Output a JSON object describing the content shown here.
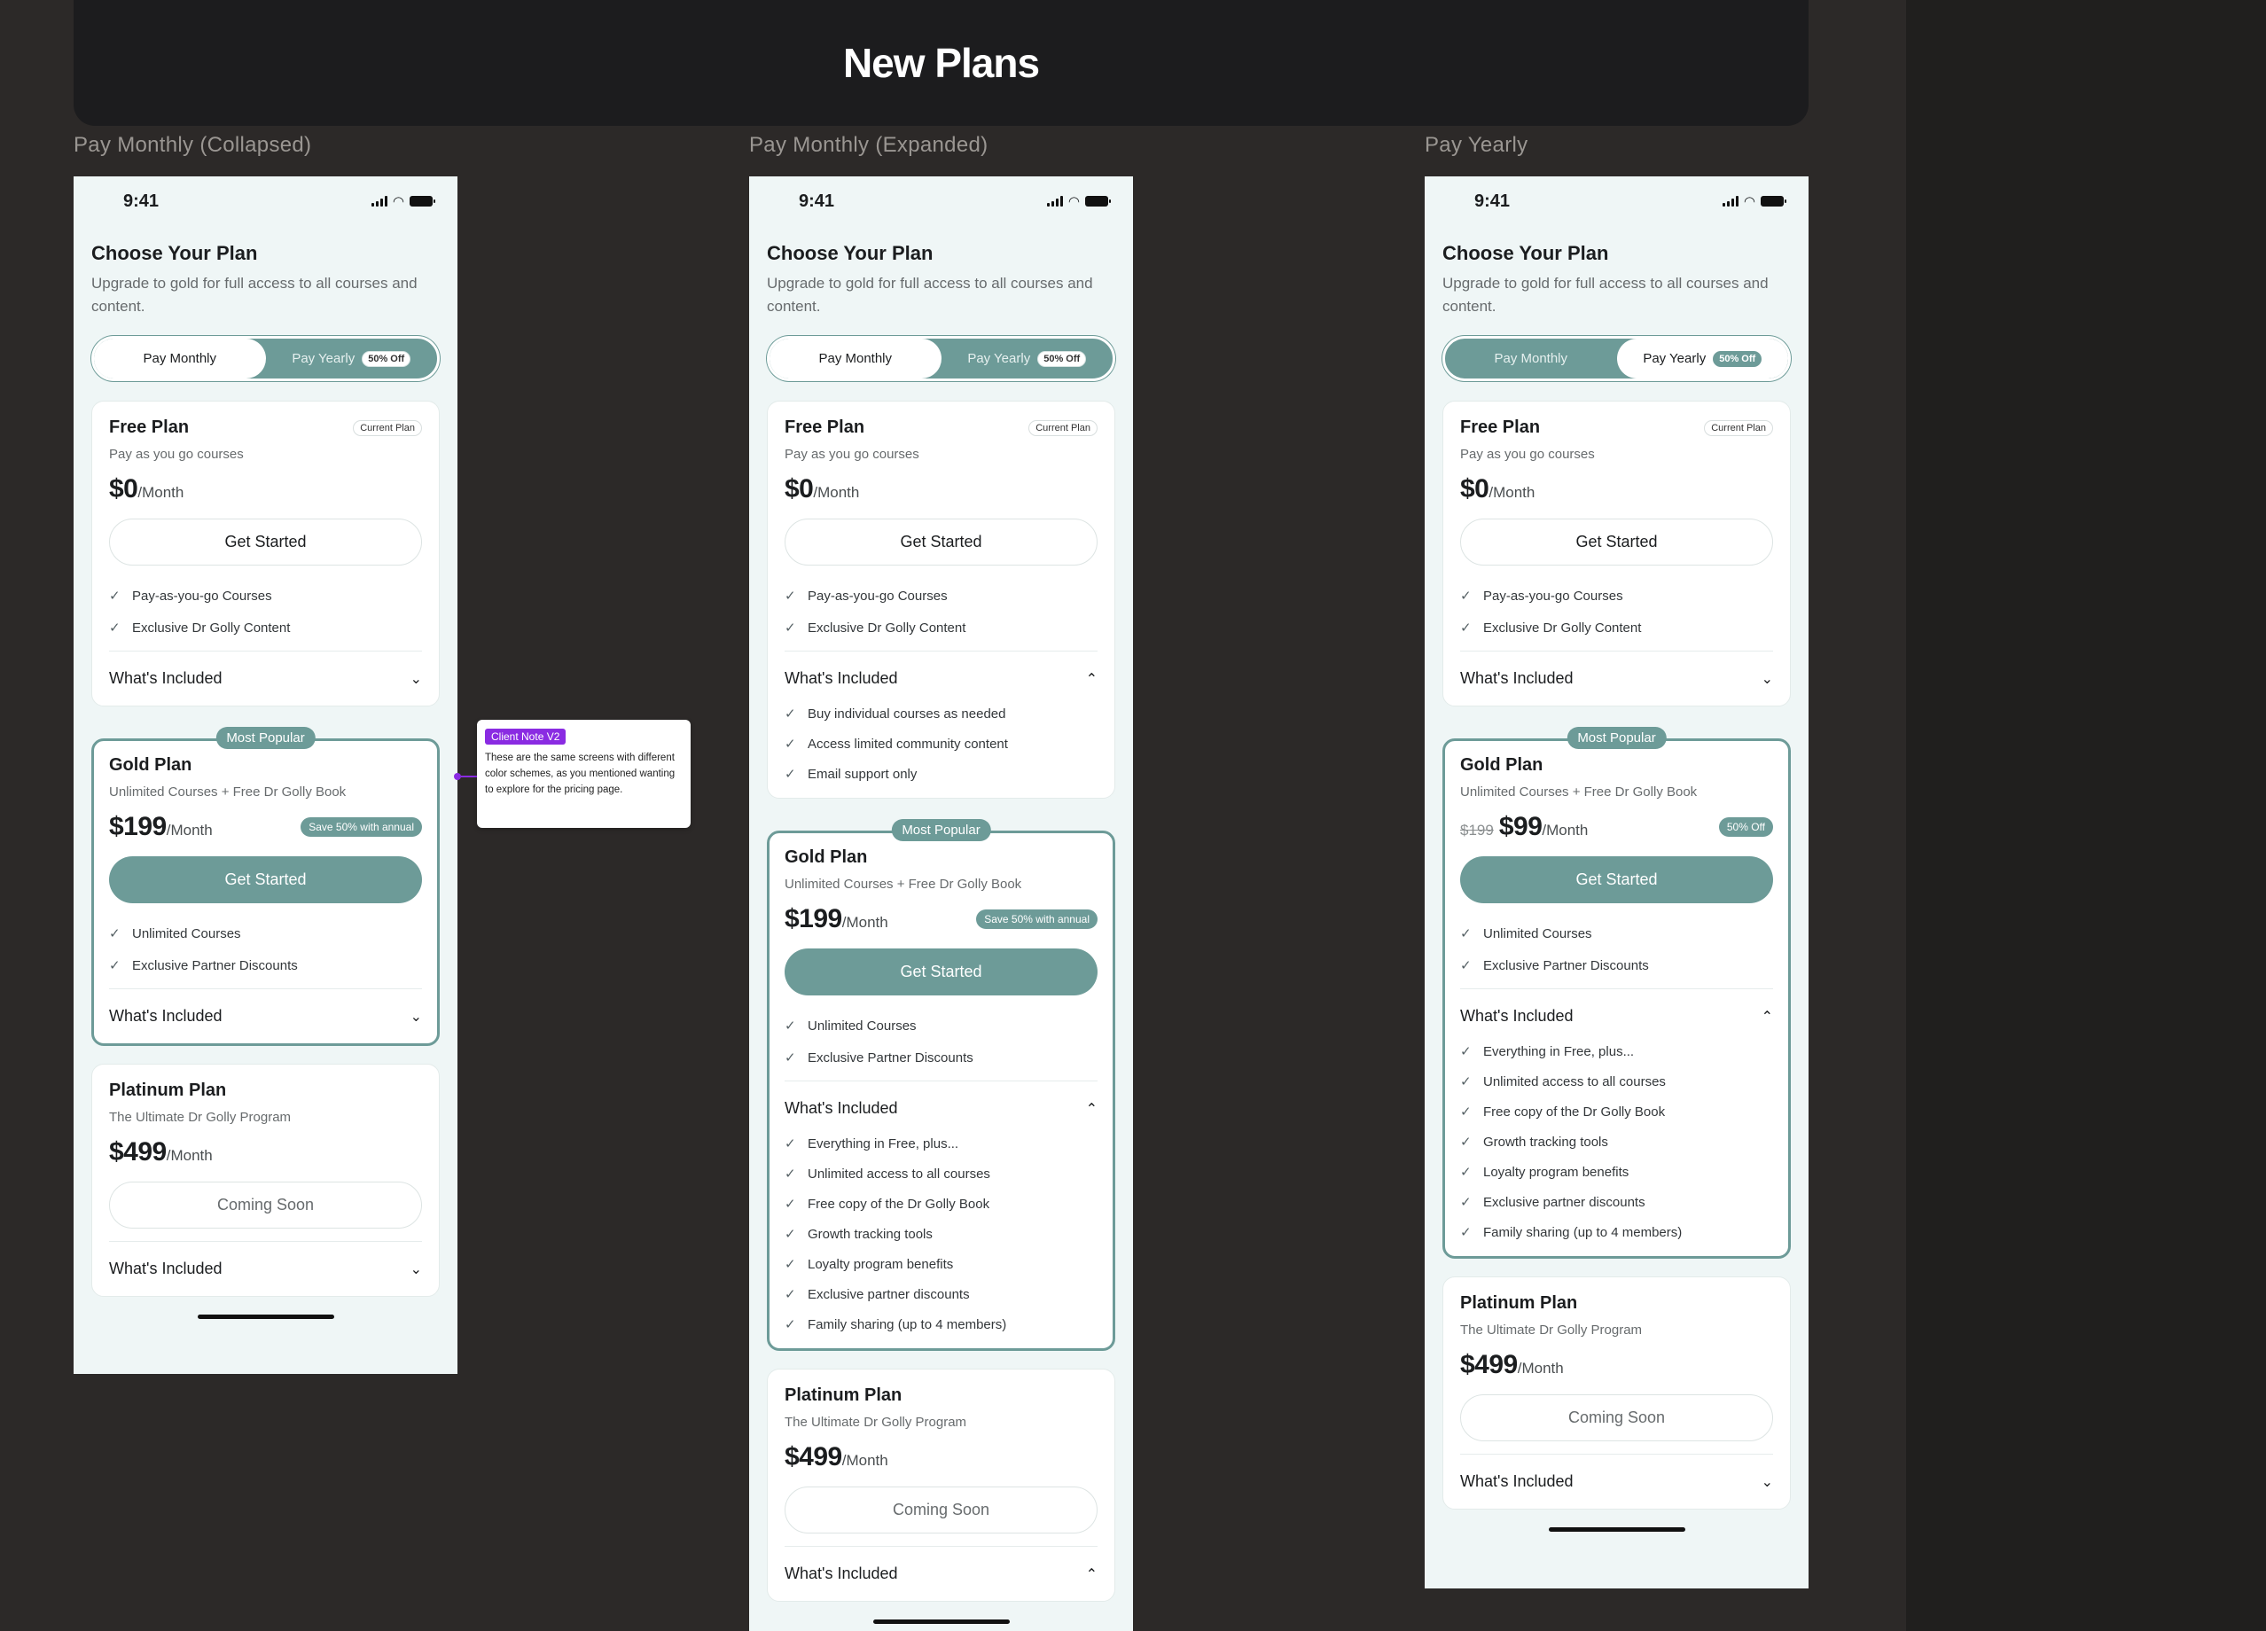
{
  "banner": {
    "title": "New Plans"
  },
  "frames": [
    {
      "label": "Pay Monthly (Collapsed)",
      "active_tab": "monthly",
      "gold_price_mode": "monthly",
      "expanded": {
        "free": false,
        "gold": false,
        "platinum": false
      }
    },
    {
      "label": "Pay Monthly (Expanded)",
      "active_tab": "monthly",
      "gold_price_mode": "monthly",
      "expanded": {
        "free": true,
        "gold": true,
        "platinum": true
      }
    },
    {
      "label": "Pay Yearly",
      "active_tab": "yearly",
      "gold_price_mode": "yearly",
      "expanded": {
        "free": false,
        "gold": true,
        "platinum": false
      }
    }
  ],
  "status": {
    "time": "9:41"
  },
  "header": {
    "title": "Choose Your Plan",
    "subtitle": "Upgrade to gold for full access to all courses and content."
  },
  "toggle": {
    "monthly": "Pay Monthly",
    "yearly": "Pay Yearly",
    "off_badge": "50% Off"
  },
  "free": {
    "name": "Free Plan",
    "badge": "Current Plan",
    "sub": "Pay as you go courses",
    "amount": "$0",
    "per": "/Month",
    "cta": "Get Started",
    "features": [
      "Pay-as-you-go Courses",
      "Exclusive Dr Golly Content"
    ],
    "included_label": "What's Included",
    "included": [
      "Buy individual courses as needed",
      "Access limited community content",
      "Email support only"
    ]
  },
  "gold": {
    "ribbon": "Most Popular",
    "name": "Gold Plan",
    "sub": "Unlimited Courses + Free Dr Golly Book",
    "amount_monthly": "$199",
    "amount_yearly": "$99",
    "strike_yearly": "$199",
    "per": "/Month",
    "save_monthly": "Save 50% with annual",
    "save_yearly": "50% Off",
    "cta": "Get Started",
    "features": [
      "Unlimited Courses",
      "Exclusive Partner Discounts"
    ],
    "included_label": "What's Included",
    "included": [
      "Everything in Free, plus...",
      "Unlimited access to all courses",
      "Free copy of the Dr Golly Book",
      "Growth tracking tools",
      "Loyalty program benefits",
      "Exclusive partner discounts",
      "Family sharing (up to 4 members)"
    ]
  },
  "platinum": {
    "name": "Platinum Plan",
    "sub": "The Ultimate Dr Golly Program",
    "amount": "$499",
    "per": "/Month",
    "cta": "Coming Soon",
    "included_label": "What's Included"
  },
  "client_note": {
    "tag": "Client Note V2",
    "text": "These are the same screens with different color schemes, as you mentioned wanting to explore for the pricing page."
  },
  "icons": {
    "check": "check-icon",
    "chevron_down": "chevron-down-icon",
    "chevron_up": "chevron-up-icon"
  },
  "colors": {
    "accent": "#6d9b98",
    "note": "#8a2be2",
    "banner": "#1c1c1e"
  }
}
